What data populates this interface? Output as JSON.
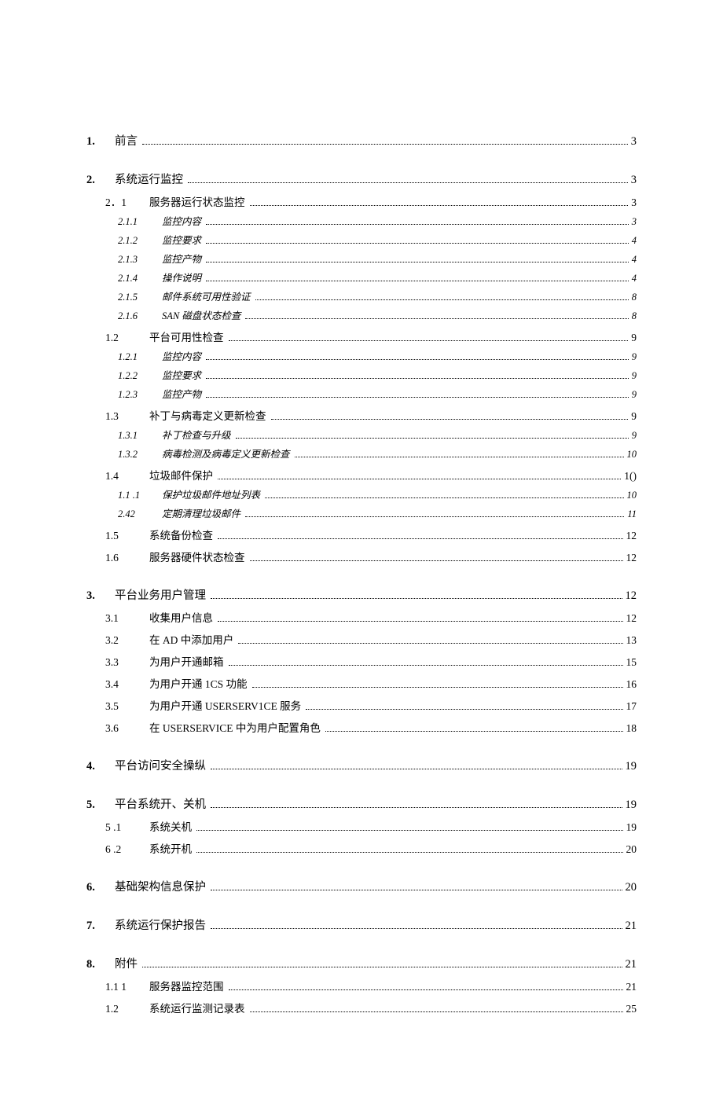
{
  "toc": [
    {
      "lvl": 1,
      "num": "1.",
      "title": "前言",
      "page": "3"
    },
    {
      "lvl": 1,
      "num": "2.",
      "title": "系统运行监控",
      "page": "3"
    },
    {
      "lvl": 2,
      "num": "2．1",
      "title": "服务器运行状态监控",
      "page": "3"
    },
    {
      "lvl": 3,
      "num": "2.1.1",
      "title": "监控内容",
      "page": "3"
    },
    {
      "lvl": 3,
      "num": "2.1.2",
      "title": "监控要求",
      "page": "4"
    },
    {
      "lvl": 3,
      "num": "2.1.3",
      "title": "监控产物",
      "page": "4"
    },
    {
      "lvl": 3,
      "num": "2.1.4",
      "title": "操作说明",
      "page": "4"
    },
    {
      "lvl": 3,
      "num": "2.1.5",
      "title": "邮件系统可用性验证",
      "page": "8"
    },
    {
      "lvl": 3,
      "num": "2.1.6",
      "title": "SAN 磁盘状态检查",
      "page": "8"
    },
    {
      "lvl": 2,
      "num": "1.2",
      "title": "平台可用性检查",
      "page": "9"
    },
    {
      "lvl": 3,
      "num": "1.2.1",
      "title": "监控内容",
      "page": "9"
    },
    {
      "lvl": 3,
      "num": "1.2.2",
      "title": "监控要求",
      "page": "9"
    },
    {
      "lvl": 3,
      "num": "1.2.3",
      "title": "监控产物",
      "page": "9"
    },
    {
      "lvl": 2,
      "num": "1.3",
      "title": "补丁与病毒定义更新检查",
      "page": "9"
    },
    {
      "lvl": 3,
      "num": "1.3.1",
      "title": "补丁检查与升级",
      "page": "9"
    },
    {
      "lvl": 3,
      "num": "1.3.2",
      "title": "病毒检测及病毒定义更新检查",
      "page": "10"
    },
    {
      "lvl": 2,
      "num": "1.4",
      "title": "垃圾邮件保护",
      "page": "1()"
    },
    {
      "lvl": 3,
      "num": "1.1 .1",
      "title": "保护垃圾邮件地址列表",
      "page": "10"
    },
    {
      "lvl": 3,
      "num": "2.42",
      "title": "定期清理垃圾邮件",
      "page": "11"
    },
    {
      "lvl": 2,
      "num": "1.5",
      "title": "系统备份检查",
      "page": "12"
    },
    {
      "lvl": 2,
      "num": "1.6",
      "title": "服务器硬件状态检查",
      "page": "12"
    },
    {
      "lvl": 1,
      "num": "3.",
      "title": "平台业务用户管理",
      "page": "12"
    },
    {
      "lvl": 2,
      "num": "3.1",
      "title": "收集用户信息",
      "page": "12"
    },
    {
      "lvl": 2,
      "num": "3.2",
      "title": "在 AD 中添加用户",
      "page": "13"
    },
    {
      "lvl": 2,
      "num": "3.3",
      "title": "为用户开通邮箱",
      "page": "15"
    },
    {
      "lvl": 2,
      "num": "3.4",
      "title": "为用户开通 1CS 功能",
      "page": "16"
    },
    {
      "lvl": 2,
      "num": "3.5",
      "title": "为用户开通 USERSERV1CE 服务",
      "page": "17"
    },
    {
      "lvl": 2,
      "num": "3.6",
      "title": "在 USERSERVICE 中为用户配置角色",
      "page": "18"
    },
    {
      "lvl": 1,
      "num": "4.",
      "title": "平台访问安全操纵",
      "page": "19"
    },
    {
      "lvl": 1,
      "num": "5.",
      "title": "平台系统开、关机",
      "page": "19"
    },
    {
      "lvl": 2,
      "num": "5 .1",
      "title": "系统关机",
      "page": "19"
    },
    {
      "lvl": 2,
      "num": "6 .2",
      "title": "系统开机",
      "page": "20"
    },
    {
      "lvl": 1,
      "num": "6.",
      "title": "基础架构信息保护",
      "page": "20"
    },
    {
      "lvl": 1,
      "num": "7.",
      "title": "系统运行保护报告",
      "page": "21"
    },
    {
      "lvl": 1,
      "num": "8.",
      "title": "附件",
      "page": "21"
    },
    {
      "lvl": 2,
      "num": "1.1 1",
      "title": "服务器监控范围",
      "page": "21"
    },
    {
      "lvl": 2,
      "num": "1.2",
      "title": "系统运行监测记录表",
      "page": "25"
    }
  ]
}
